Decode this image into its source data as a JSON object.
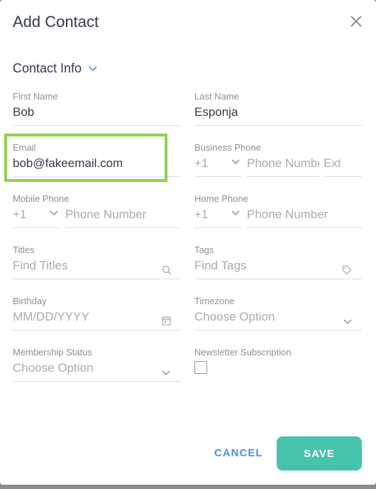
{
  "modal": {
    "title": "Add Contact",
    "section_title": "Contact Info"
  },
  "fields": {
    "first_name": {
      "label": "First Name",
      "value": "Bob"
    },
    "last_name": {
      "label": "Last Name",
      "value": "Esponja"
    },
    "email": {
      "label": "Email",
      "value": "bob@fakeemail.com"
    },
    "business_phone": {
      "label": "Business Phone",
      "code": "+1",
      "placeholder": "Phone Number",
      "ext_placeholder": "Ext"
    },
    "mobile_phone": {
      "label": "Mobile Phone",
      "code": "+1",
      "placeholder": "Phone Number"
    },
    "home_phone": {
      "label": "Home Phone",
      "code": "+1",
      "placeholder": "Phone Number"
    },
    "titles": {
      "label": "Titles",
      "placeholder": "Find Titles"
    },
    "tags": {
      "label": "Tags",
      "placeholder": "Find Tags"
    },
    "birthday": {
      "label": "Birthday",
      "placeholder": "MM/DD/YYYY"
    },
    "timezone": {
      "label": "Timezone",
      "placeholder": "Choose Option"
    },
    "membership_status": {
      "label": "Membership Status",
      "placeholder": "Choose Option"
    },
    "newsletter": {
      "label": "Newsletter Subscription"
    }
  },
  "actions": {
    "cancel_label": "CANCEL",
    "save_label": "SAVE"
  },
  "colors": {
    "accent": "#47c3ab",
    "link": "#4a90e2",
    "highlight": "#8fd14f"
  },
  "icons": {
    "close": "close-icon",
    "section_toggle": "chevron-down-icon",
    "titles_search": "search-icon",
    "tags": "tag-icon",
    "birthday": "calendar-icon"
  }
}
